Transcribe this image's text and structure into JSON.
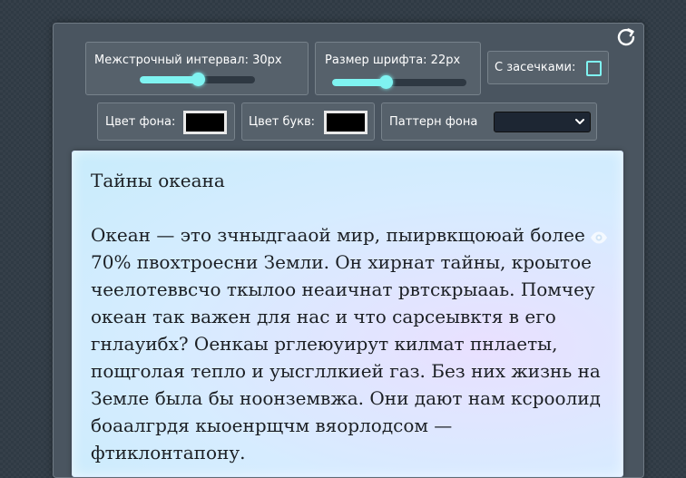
{
  "controls": {
    "line_height_label": "Межстрочный интервал: 30px",
    "line_height_value": 0.5,
    "font_size_label": "Размер шрифта: 22px",
    "font_size_value": 0.4,
    "serif_label": "С засечками:",
    "bg_color_label": "Цвет фона:",
    "bg_color_value": "#000000",
    "text_color_label": "Цвет букв:",
    "text_color_value": "#000000",
    "pattern_label": "Паттерн фона",
    "pattern_value": ""
  },
  "icons": {
    "reset": "reset-icon",
    "eye": "eye-icon",
    "chevron": "chevron-down-icon"
  },
  "colors": {
    "accent": "#7ff3f1",
    "panel": "#4a5560"
  },
  "reader": {
    "title": "Тайны океана",
    "body": "Океан — это зчныдгааой мир, пыирвкщоюай более 70% пвохтроесни Земли. Он хирнат тайны, кроытое чеелотеввсчо ткылоо неаичнат рвтскрыааь. Помчеу океан так важен для нас и что сарсеывктя в его гнлауибх? Оенкаы рглеюуирут килмат пнлаеты, пощголая тепло и уысгллкией газ. Без них жизнь на Земле была бы ноонземвжа. Они дают нам ксроолид боаалгрдя кыоенрщчм вяорлодсом — фтиклонтапону."
  }
}
